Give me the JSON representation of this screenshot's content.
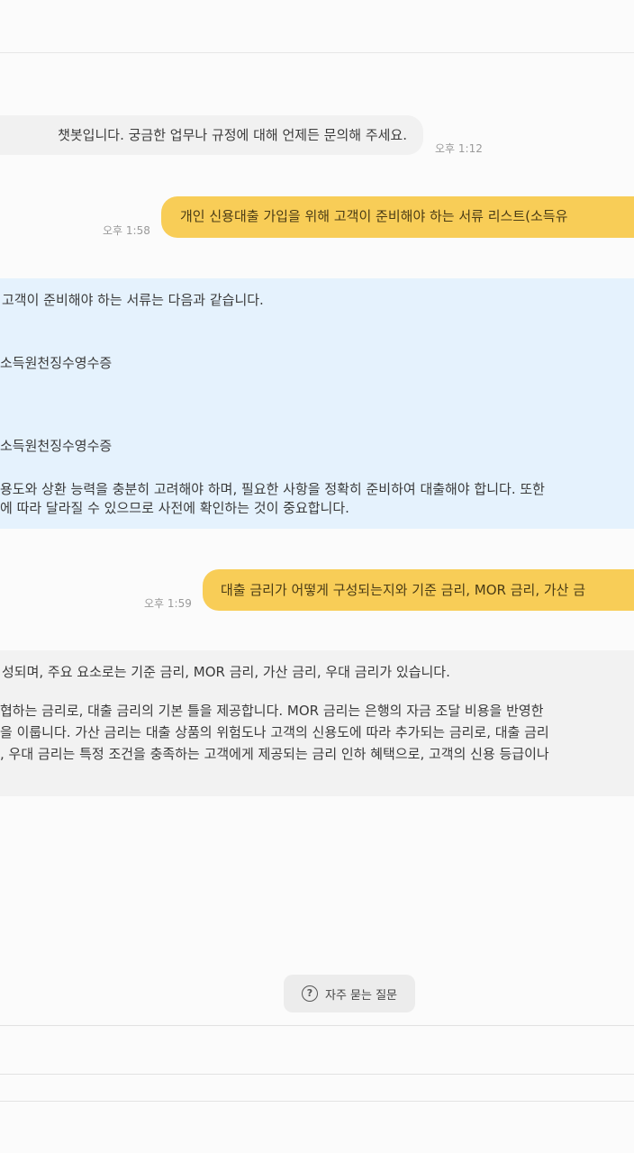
{
  "messages": {
    "greeting": {
      "text": "챗봇입니다. 궁금한 업무나 규정에 대해 언제든 문의해 주세요.",
      "time": "오후 1:12"
    },
    "question1": {
      "text": "개인 신용대출 가입을 위해 고객이 준비해야 하는 서류 리스트(소득유",
      "time": "오후 1:58"
    },
    "answer1": {
      "lines": [
        "고객이 준비해야 하는 서류는 다음과 같습니다.",
        "소득원천징수영수증",
        "소득원천징수영수증",
        "용도와 상환 능력을 충분히 고려해야 하며, 필요한 사항을 정확히 준비하여 대출해야 합니다. 또한",
        "에 따라 달라질 수 있으므로 사전에 확인하는 것이 중요합니다."
      ]
    },
    "question2": {
      "text": "대출 금리가 어떻게 구성되는지와 기준 금리, MOR 금리, 가산 금",
      "time": "오후 1:59"
    },
    "answer2": {
      "lines": [
        "성되며, 주요 요소로는 기준 금리, MOR 금리, 가산 금리, 우대 금리가 있습니다.",
        "협하는 금리로, 대출 금리의 기본 틀을 제공합니다. MOR 금리는 은행의 자금 조달 비용을 반영한",
        "을 이룹니다. 가산 금리는 대출 상품의 위험도나 고객의 신용도에 따라 추가되는 금리로, 대출 금리",
        ", 우대 금리는 특정 조건을 충족하는 고객에게 제공되는 금리 인하 혜택으로, 고객의 신용 등급이나"
      ]
    }
  },
  "faq_button": {
    "label": "자주 묻는 질문",
    "icon": "question-circle-icon"
  },
  "colors": {
    "user_bubble": "#f8cd57",
    "bot_answer_blue": "#e5f2fd",
    "bot_answer_gray": "#f2f2f2",
    "bot_bubble": "#f1f1f1"
  }
}
